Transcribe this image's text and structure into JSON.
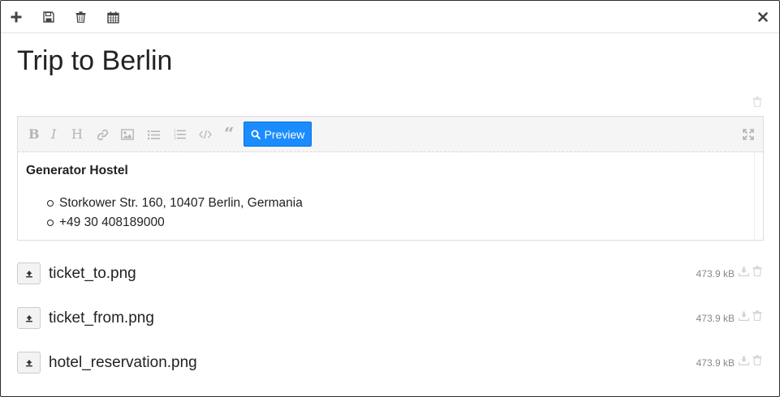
{
  "toolbar": {
    "icons": [
      "plus-icon",
      "save-icon",
      "trash-icon",
      "calendar-icon"
    ],
    "close_icon": "close-icon"
  },
  "note": {
    "title": "Trip to Berlin"
  },
  "editor": {
    "toolbar_icons": [
      "bold-icon",
      "italic-icon",
      "heading-icon",
      "link-icon",
      "image-icon",
      "bullet-list-icon",
      "numbered-list-icon",
      "code-icon",
      "quote-icon"
    ],
    "preview_label": "Preview",
    "fullscreen_icon": "fullscreen-icon",
    "content": {
      "heading": "Generator Hostel",
      "items": [
        "Storkower Str. 160, 10407 Berlin, Germania",
        "+49 30 408189000"
      ]
    }
  },
  "attachments": [
    {
      "name": "ticket_to.png",
      "size": "473.9 kB"
    },
    {
      "name": "ticket_from.png",
      "size": "473.9 kB"
    },
    {
      "name": "hotel_reservation.png",
      "size": "473.9 kB"
    }
  ],
  "colors": {
    "primary": "#1a8cff",
    "text": "#222222",
    "muted": "#888888"
  }
}
